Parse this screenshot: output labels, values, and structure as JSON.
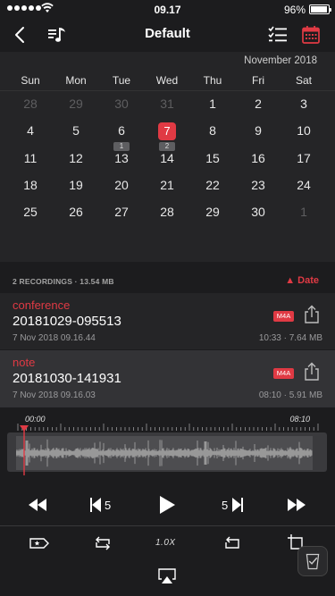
{
  "status_bar": {
    "time": "09.17",
    "battery": "96%",
    "battery_level": 0.96
  },
  "nav": {
    "title": "Default"
  },
  "calendar": {
    "month": "November 2018",
    "weekdays": [
      "Sun",
      "Mon",
      "Tue",
      "Wed",
      "Thu",
      "Fri",
      "Sat"
    ],
    "weeks": [
      [
        "28",
        "29",
        "30",
        "31",
        "1",
        "2",
        "3"
      ],
      [
        "4",
        "5",
        "6",
        "7",
        "8",
        "9",
        "10"
      ],
      [
        "11",
        "12",
        "13",
        "14",
        "15",
        "16",
        "17"
      ],
      [
        "18",
        "19",
        "20",
        "21",
        "22",
        "23",
        "24"
      ],
      [
        "25",
        "26",
        "27",
        "28",
        "29",
        "30",
        "1"
      ]
    ],
    "selected_day": "7",
    "badges": {
      "6": "1",
      "7": "2"
    }
  },
  "recordings": {
    "summary": "2 RECORDINGS",
    "total_size": "13.54 MB",
    "sort_label": "Date",
    "items": [
      {
        "label": "conference",
        "name": "20181029-095513",
        "date": "7 Nov 2018 09.16.44",
        "format": "M4A",
        "duration": "10:33",
        "size": "7.64 MB"
      },
      {
        "label": "note",
        "name": "20181030-141931",
        "date": "7 Nov 2018 09.16.03",
        "format": "M4A",
        "duration": "08:10",
        "size": "5.91 MB"
      }
    ]
  },
  "player": {
    "time_start": "00:00",
    "time_end": "08:10",
    "skip_back": "5",
    "skip_forward": "5",
    "speed": "1.0X",
    "position": 0
  },
  "colors": {
    "accent": "#e03a44",
    "background": "#1c1c1e",
    "panel": "#252527"
  }
}
